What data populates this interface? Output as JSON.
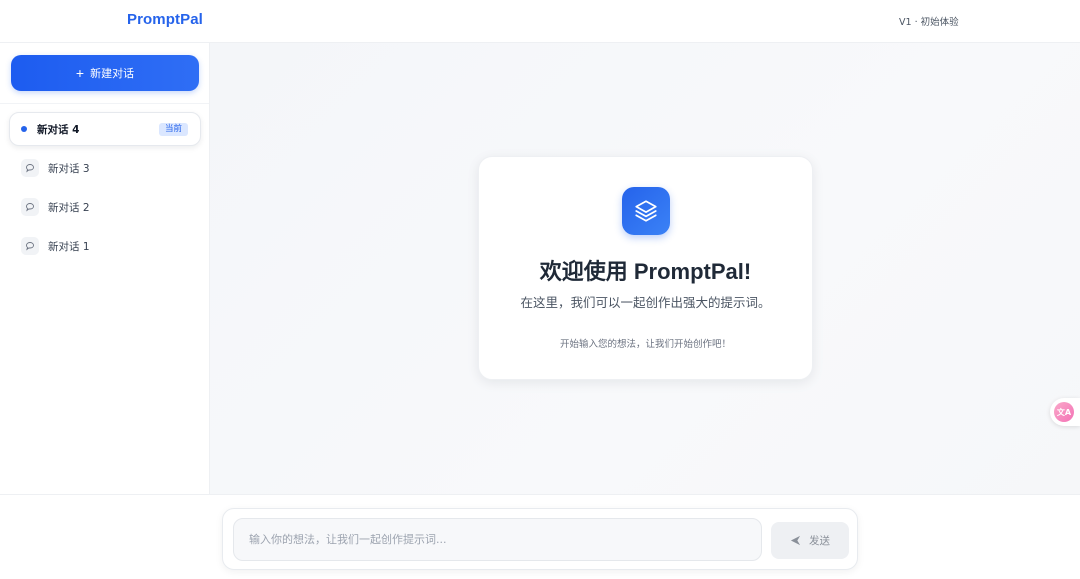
{
  "header": {
    "brand": "PromptPal",
    "version": "V1 · 初始体验"
  },
  "sidebar": {
    "new_chat_label": "新建对话",
    "conversations": [
      {
        "label": "新对话 4",
        "active": true,
        "badge": "当前"
      },
      {
        "label": "新对话 3",
        "active": false
      },
      {
        "label": "新对话 2",
        "active": false
      },
      {
        "label": "新对话 1",
        "active": false
      }
    ]
  },
  "welcome": {
    "title": "欢迎使用 PromptPal!",
    "subtitle": "在这里，我们可以一起创作出强大的提示词。",
    "hint": "开始输入您的想法，让我们开始创作吧！"
  },
  "composer": {
    "placeholder": "输入你的想法，让我们一起创作提示词...",
    "value": "",
    "send_label": "发送"
  },
  "translate": {
    "label": "文A"
  },
  "colors": {
    "accent": "#2563eb",
    "badge_bg": "#dbe7ff",
    "fab_pink": "#f472b6"
  },
  "icons": {
    "new_chat": "plus-icon",
    "active_marker": "dot-icon",
    "conversation": "chat-bubble-icon",
    "logo": "layers-icon",
    "send": "send-arrow-icon",
    "translate": "translate-icon"
  }
}
